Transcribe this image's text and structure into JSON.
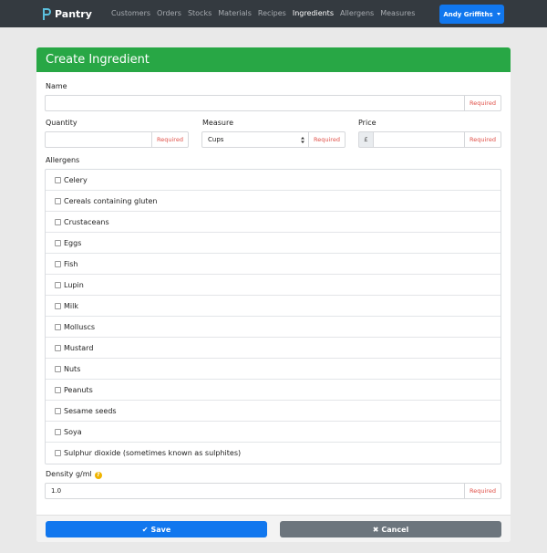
{
  "navbar": {
    "brand": "Pantry",
    "links": [
      "Customers",
      "Orders",
      "Stocks",
      "Materials",
      "Recipes",
      "Ingredients",
      "Allergens",
      "Measures"
    ],
    "active_link": "Ingredients",
    "user": "Andy Griffiths"
  },
  "form": {
    "title": "Create Ingredient",
    "name_label": "Name",
    "name_value": "",
    "quantity_label": "Quantity",
    "quantity_value": "",
    "measure_label": "Measure",
    "measure_value": "Cups",
    "price_label": "Price",
    "price_prefix": "£",
    "price_value": "",
    "required_text": "Required",
    "allergens_label": "Allergens",
    "allergens": [
      "Celery",
      "Cereals containing gluten",
      "Crustaceans",
      "Eggs",
      "Fish",
      "Lupin",
      "Milk",
      "Molluscs",
      "Mustard",
      "Nuts",
      "Peanuts",
      "Sesame seeds",
      "Soya",
      "Sulphur dioxide (sometimes known as sulphites)"
    ],
    "density_label": "Density g/ml",
    "density_help": "?",
    "density_value": "1.0",
    "save_label": "Save",
    "cancel_label": "Cancel"
  },
  "colors": {
    "navbar": "#343a40",
    "header_green": "#28a745",
    "primary_blue": "#1177ee",
    "cancel_gray": "#6c757d",
    "required_red": "#e0524a"
  }
}
